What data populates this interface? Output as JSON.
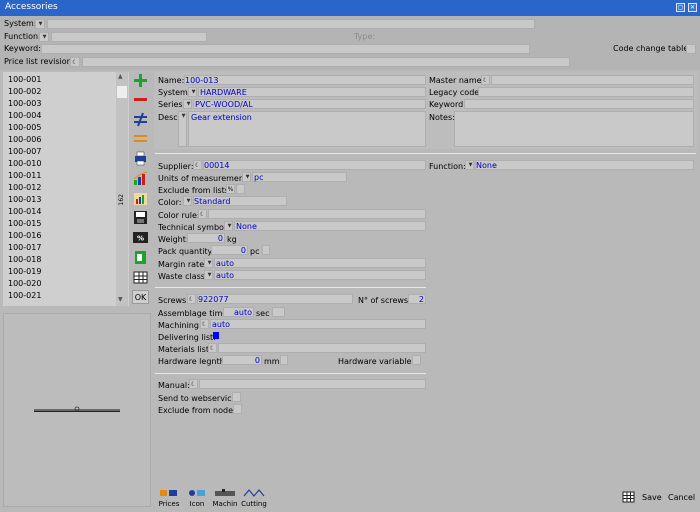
{
  "window": {
    "title": "Accessories"
  },
  "filters": {
    "system_label": "System:",
    "function_label": "Function:",
    "type_label": "Type:",
    "keyword_label": "Keyword:",
    "code_change_label": "Code change table:",
    "price_list_label": "Price list revision:"
  },
  "list": {
    "items": [
      "100-001",
      "100-002",
      "100-003",
      "100-004",
      "100-005",
      "100-006",
      "100-007",
      "100-010",
      "100-011",
      "100-012",
      "100-013",
      "100-014",
      "100-015",
      "100-016",
      "100-017",
      "100-018",
      "100-019",
      "100-020",
      "100-021"
    ],
    "selected_index": 10,
    "count_badge": "162"
  },
  "toolbar": {
    "ok_label": "OK"
  },
  "header": {
    "name_label": "Name:",
    "name_value": "100-013",
    "system_label": "System:",
    "system_value": "HARDWARE",
    "series_label": "Series:",
    "series_value": "PVC-WOOD/AL",
    "desc_label": "Desc:",
    "desc_value": "Gear extension",
    "master_name_label": "Master name:",
    "legacy_code_label": "Legacy code:",
    "keyword_label": "Keyword:",
    "notes_label": "Notes:"
  },
  "details": {
    "supplier_label": "Supplier:",
    "supplier_value": "00014",
    "function_label": "Function:",
    "function_value": "None",
    "uom_label": "Units of measurement:",
    "uom_value": "pc",
    "exclude_lists_label": "Exclude from lists:",
    "color_label": "Color:",
    "color_value": "Standard",
    "color_rule_label": "Color rule:",
    "tech_symbol_label": "Technical symbol:",
    "tech_symbol_value": "None",
    "weight_label": "Weight:",
    "weight_value": "0",
    "weight_unit": "kg",
    "pack_qty_label": "Pack quantity:",
    "pack_qty_value": "0",
    "pack_qty_unit": "pc",
    "margin_rate_label": "Margin rate:",
    "margin_rate_value": "auto",
    "waste_class_label": "Waste class:",
    "waste_class_value": "auto",
    "screws_label": "Screws:",
    "screws_value": "922077",
    "num_screws_label": "N° of screws:",
    "num_screws_value": "2",
    "assemblage_label": "Assemblage time:",
    "assemblage_value": "auto",
    "assemblage_unit": "sec",
    "machining_label": "Machining:",
    "machining_value": "auto",
    "delivering_label": "Delivering list:",
    "materials_label": "Materials list:",
    "hw_length_label": "Hardware legnth:",
    "hw_length_value": "0",
    "hw_length_unit": "mm",
    "hw_vars_label": "Hardware variables:",
    "manual_label": "Manual:",
    "send_ws_label": "Send to webservice:",
    "exclude_nodes_label": "Exclude from nodes:"
  },
  "bottom": {
    "tabs": [
      "Prices",
      "Icon",
      "Machin",
      "Cutting"
    ],
    "save_label": "Save",
    "cancel_label": "Cancel"
  },
  "colors": {
    "titlebar": "#2a66c9",
    "value_text": "#0000c8",
    "selection": "#0000ff"
  }
}
